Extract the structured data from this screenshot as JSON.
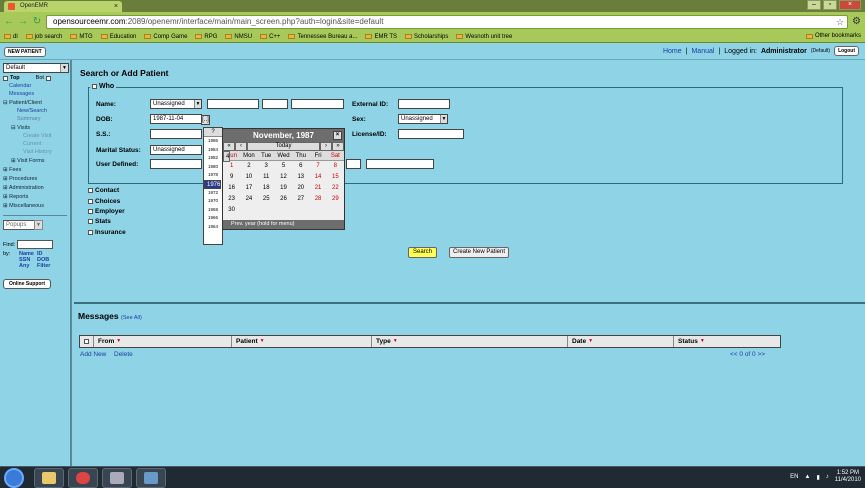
{
  "browser": {
    "tab_title": "OpenEMR",
    "url_host": "opensourceemr.com",
    "url_rest": ":2089/openemr/interface/main/main_screen.php?auth=login&site=default",
    "bookmarks": [
      "dl",
      "job search",
      "MTG",
      "Education",
      "Comp Game",
      "RPG",
      "NMSU",
      "C++",
      "Tennessee Bureau a...",
      "EMR TS",
      "Scholarships",
      "Wesnoth unit tree"
    ],
    "other_bookmarks": "Other bookmarks"
  },
  "app": {
    "new_patient": "NEW PATIENT",
    "home": "Home",
    "manual": "Manual",
    "logged_in_label": "Logged in:",
    "user": "Administrator",
    "user_suffix": "(Default)",
    "logout": "Logout"
  },
  "leftnav": {
    "frame_select": "Default",
    "top_label": "Top",
    "bot_label": "Bot",
    "links": [
      "Calendar",
      "Messages"
    ],
    "patient_client": "Patient/Client",
    "new_search": "New/Search",
    "summary": "Summary",
    "visits": "Visits",
    "visit_sub": [
      "Create Visit",
      "Current",
      "Visit History"
    ],
    "visit_forms": "Visit Forms",
    "sections": [
      "Fees",
      "Procedures",
      "Administration",
      "Reports",
      "Miscellaneous"
    ],
    "popups": "Popups",
    "find_label": "Find:",
    "by_label": "by:",
    "by_options": [
      "Name",
      "ID",
      "SSN",
      "DOB",
      "Any",
      "Filter"
    ],
    "online_support": "Online Support"
  },
  "search": {
    "title": "Search or Add Patient",
    "who_label": "Who",
    "name_label": "Name:",
    "name_title": "Unassigned",
    "dob_label": "DOB:",
    "dob_value": "1987-11-04",
    "dob_btn": "[..]",
    "ss_label": "S.S.:",
    "marital_label": "Marital Status:",
    "marital_value": "Unassigned",
    "user_defined_label": "User Defined:",
    "external_id_label": "External ID:",
    "sex_label": "Sex:",
    "sex_value": "Unassigned",
    "license_label": "License/ID:",
    "sections": [
      "Contact",
      "Choices",
      "Employer",
      "Stats",
      "Insurance"
    ],
    "search_btn": "Search",
    "create_btn": "Create New Patient"
  },
  "calendar": {
    "title": "November, 1987",
    "close": "×",
    "help": "?",
    "prev_year": "«",
    "prev_month": "‹",
    "today": "Today",
    "next_month": "›",
    "next_year": "»",
    "day_headers": [
      "Sun",
      "Mon",
      "Tue",
      "Wed",
      "Thu",
      "Fri",
      "Sat"
    ],
    "weeks": [
      [
        "1",
        "2",
        "3",
        "4",
        "5",
        "6",
        "7"
      ],
      [
        "8",
        "9",
        "10",
        "11",
        "12",
        "13",
        "14"
      ],
      [
        "15",
        "16",
        "17",
        "18",
        "19",
        "20",
        "21"
      ],
      [
        "22",
        "23",
        "24",
        "25",
        "26",
        "27",
        "28"
      ],
      [
        "29",
        "30",
        "",
        "",
        "",
        "",
        ""
      ]
    ],
    "selected_day": "4",
    "status": "Prev. year (hold for menu)",
    "year_list": [
      "1986",
      "1984",
      "1982",
      "1980",
      "1978",
      "1976",
      "1974",
      "1972",
      "1970",
      "1968",
      "1966",
      "1964"
    ],
    "selected_year": "1976"
  },
  "messages": {
    "title": "Messages",
    "see_all": "(See All)",
    "columns": [
      "From",
      "Patient",
      "Type",
      "Date",
      "Status"
    ],
    "add_new": "Add New",
    "delete": "Delete",
    "pager": "<< 0 of 0 >>"
  },
  "taskbar": {
    "lang": "EN",
    "time": "1:52 PM",
    "date": "11/4/2010"
  }
}
